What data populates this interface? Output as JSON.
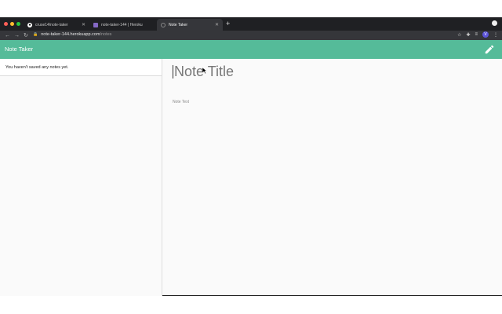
{
  "browser": {
    "tabs": [
      {
        "label": "cruse14/note-taker",
        "icon": "github-icon"
      },
      {
        "label": "note-taker-144 | Heroku",
        "icon": "heroku-icon"
      },
      {
        "label": "Note Taker",
        "icon": "globe-icon",
        "active": true
      }
    ],
    "url_host": "note-taker-144.herokuapp.com",
    "url_path": "/notes",
    "profile_initial": "V"
  },
  "app": {
    "brand": "Note Taker",
    "accent_color": "#55bb99",
    "empty_message": "You haven't saved any notes yet.",
    "note_title_placeholder": "Note Title",
    "note_text_placeholder": "Note Text"
  }
}
